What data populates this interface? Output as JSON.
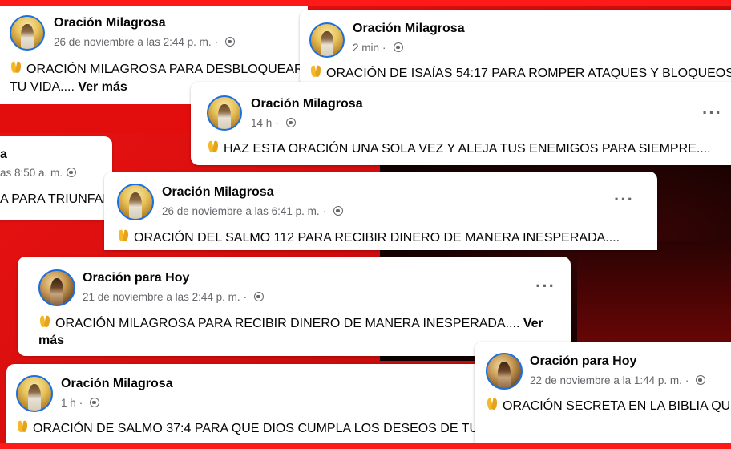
{
  "posts": [
    {
      "name": "Oración Milagrosa",
      "meta": "26 de noviembre a las 2:44 p. m.",
      "text": "ORACIÓN MILAGROSA PARA DESBLOQUEAR",
      "text2": "TU VIDA....",
      "more": "Ver más"
    },
    {
      "name": "Oración Milagrosa",
      "meta": "2 min",
      "text": "ORACIÓN DE ISAÍAS 54:17 PARA ROMPER ATAQUES Y BLOQUEOS."
    },
    {
      "name": "Oración Milagrosa",
      "meta": "14 h",
      "text": "HAZ ESTA ORACIÓN UNA SOLA VEZ Y ALEJA TUS ENEMIGOS PARA SIEMPRE...."
    },
    {
      "name": "a",
      "meta": "as 8:50 a. m.",
      "text": "A PARA TRIUNFAR"
    },
    {
      "name": "Oración Milagrosa",
      "meta": "26 de noviembre a las 6:41 p. m.",
      "text": "ORACIÓN DEL SALMO 112 PARA RECIBIR DINERO DE MANERA INESPERADA...."
    },
    {
      "name": "Oración para Hoy",
      "meta": "21 de noviembre a las 2:44 p. m.",
      "text": "ORACIÓN MILAGROSA PARA RECIBIR DINERO DE MANERA INESPERADA....",
      "more": "Ver",
      "more2": "más"
    },
    {
      "name": "Oración para Hoy",
      "meta": "22 de noviembre a la 1:44 p. m.",
      "text": "ORACIÓN SECRETA EN LA BIBLIA QU"
    },
    {
      "name": "Oración Milagrosa",
      "meta": "1 h",
      "text": "ORACIÓN DE SALMO 37:4 PARA QUE DIOS CUMPLA LOS DESEOS DE TU"
    }
  ],
  "icons": {
    "globe": "globe-icon",
    "pray": "praying-hands-emoji",
    "more": "more-options-icon"
  },
  "colors": {
    "background": "#e01010",
    "card": "#ffffff",
    "meta_text": "#65676b",
    "avatar_ring": "#1b6fe0"
  }
}
